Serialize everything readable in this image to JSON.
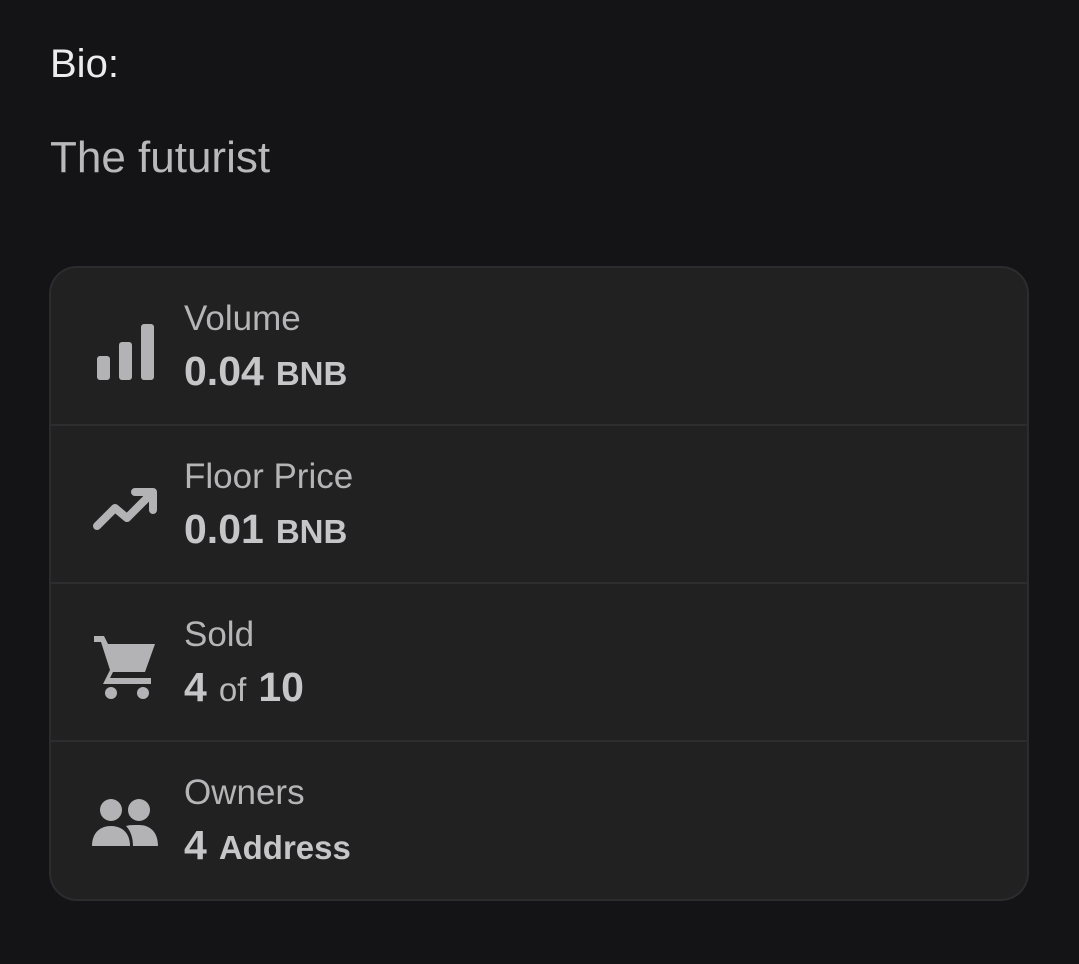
{
  "bio": {
    "label": "Bio:",
    "text": "The futurist"
  },
  "stats": [
    {
      "icon": "bar-chart-icon",
      "label": "Volume",
      "value": "0.04",
      "unit": "BNB"
    },
    {
      "icon": "trending-up-icon",
      "label": "Floor Price",
      "value": "0.01",
      "unit": "BNB"
    },
    {
      "icon": "shopping-cart-icon",
      "label": "Sold",
      "value": "4",
      "connector": "of",
      "total": "10"
    },
    {
      "icon": "people-icon",
      "label": "Owners",
      "value": "4",
      "unit": "Address"
    }
  ],
  "colors": {
    "background": "#141417",
    "card": "#212121",
    "icon": "#b3b3b5"
  }
}
